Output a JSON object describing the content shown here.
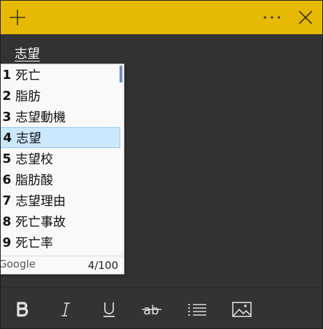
{
  "note": {
    "text": "志望"
  },
  "ime": {
    "candidates": [
      {
        "num": "1",
        "text": "死亡"
      },
      {
        "num": "2",
        "text": "脂肪"
      },
      {
        "num": "3",
        "text": "志望動機"
      },
      {
        "num": "4",
        "text": "志望"
      },
      {
        "num": "5",
        "text": "志望校"
      },
      {
        "num": "6",
        "text": "脂肪酸"
      },
      {
        "num": "7",
        "text": "志望理由"
      },
      {
        "num": "8",
        "text": "死亡事故"
      },
      {
        "num": "9",
        "text": "死亡率"
      }
    ],
    "selected_index": 3,
    "brand": "Google",
    "count": "4/100"
  },
  "toolbar": {
    "icons": [
      "bold-icon",
      "italic-icon",
      "underline-icon",
      "strikethrough-icon",
      "bullet-list-icon",
      "image-icon"
    ]
  },
  "colors": {
    "titlebar": "#e6b905",
    "body": "#333333",
    "selection": "#cce8ff"
  }
}
